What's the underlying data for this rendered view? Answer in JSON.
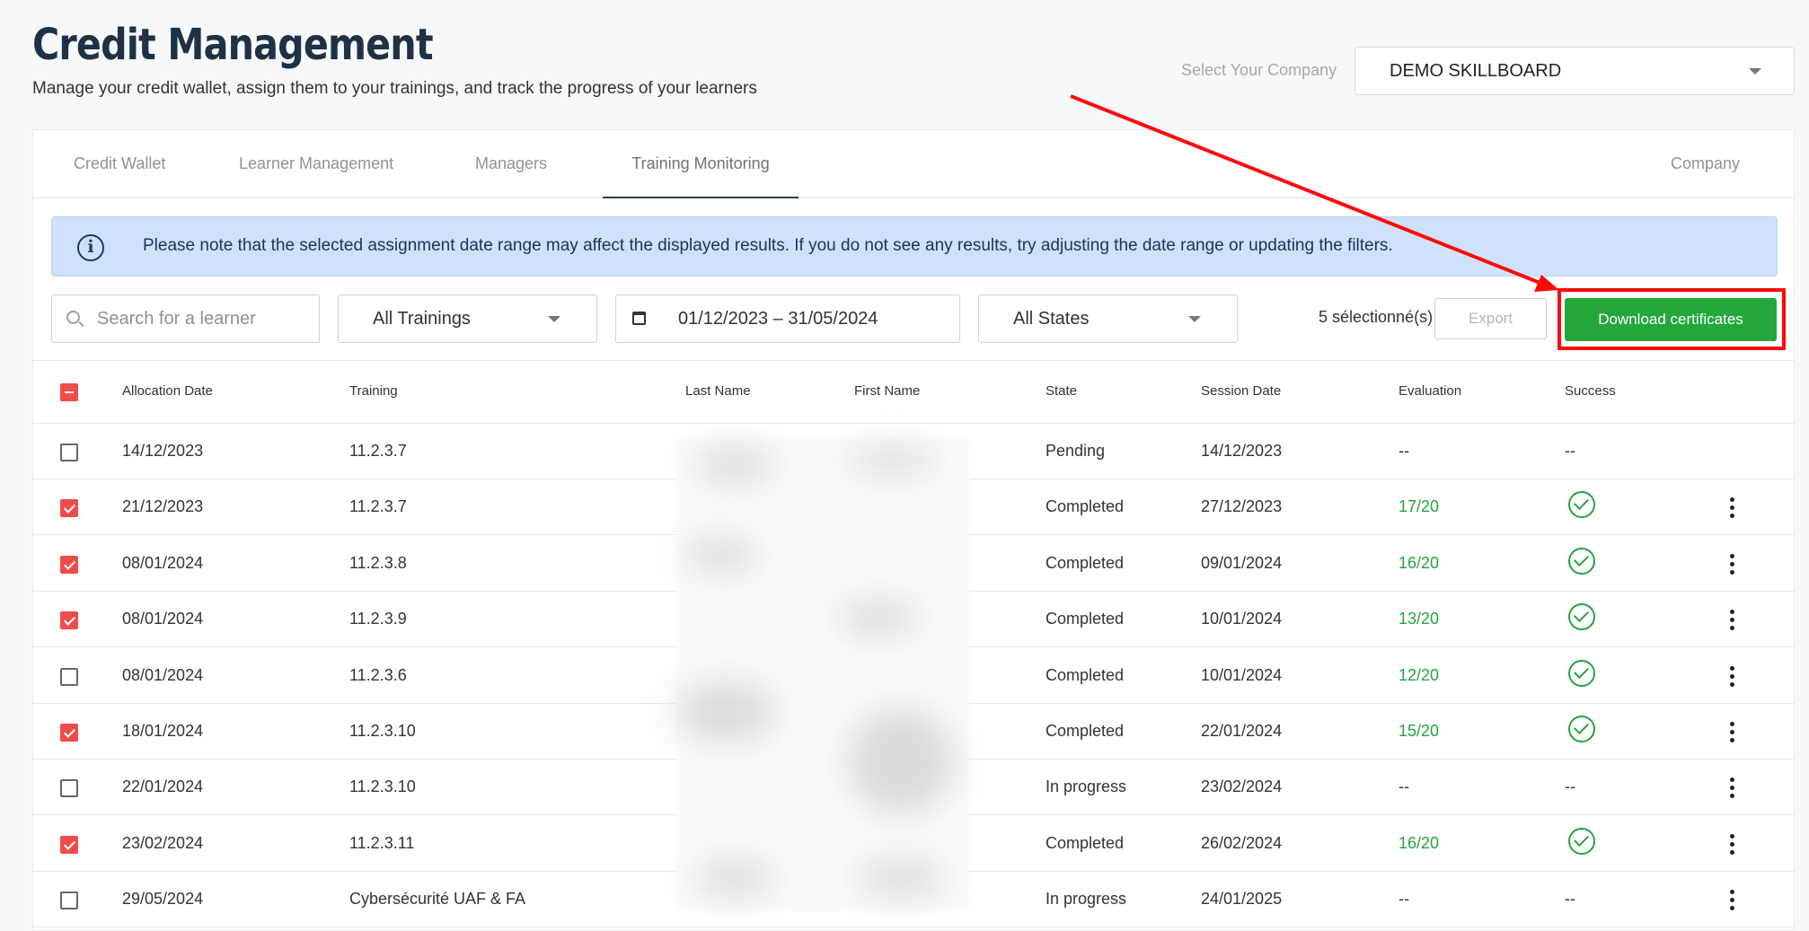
{
  "page": {
    "title": "Credit Management",
    "subtitle": "Manage your credit wallet, assign them to your trainings, and track the progress of your learners"
  },
  "company": {
    "label": "Select Your Company",
    "selected": "DEMO SKILLBOARD"
  },
  "tabs": [
    {
      "label": "Credit Wallet",
      "active": false
    },
    {
      "label": "Learner Management",
      "active": false
    },
    {
      "label": "Managers",
      "active": false
    },
    {
      "label": "Training Monitoring",
      "active": true
    },
    {
      "label": "Company",
      "active": false
    }
  ],
  "alert": {
    "text": "Please note that the selected assignment date range may affect the displayed results. If you do not see any results, try adjusting the date range or updating the filters."
  },
  "filters": {
    "search_placeholder": "Search for a learner",
    "training": "All Trainings",
    "date_range": "01/12/2023 – 31/05/2024",
    "state": "All States"
  },
  "toolbar": {
    "selected_count": "5 sélectionné(s)",
    "export_label": "Export",
    "download_label": "Download certificates"
  },
  "table": {
    "headers": [
      "Allocation Date",
      "Training",
      "Last Name",
      "First Name",
      "State",
      "Session Date",
      "Evaluation",
      "Success"
    ],
    "rows": [
      {
        "checked": false,
        "allocation_date": "14/12/2023",
        "training": "11.2.3.7",
        "state": "Pending",
        "session_date": "14/12/2023",
        "evaluation": "--",
        "success": "--"
      },
      {
        "checked": true,
        "allocation_date": "21/12/2023",
        "training": "11.2.3.7",
        "state": "Completed",
        "session_date": "27/12/2023",
        "evaluation": "17/20",
        "success": "check"
      },
      {
        "checked": true,
        "allocation_date": "08/01/2024",
        "training": "11.2.3.8",
        "state": "Completed",
        "session_date": "09/01/2024",
        "evaluation": "16/20",
        "success": "check"
      },
      {
        "checked": true,
        "allocation_date": "08/01/2024",
        "training": "11.2.3.9",
        "state": "Completed",
        "session_date": "10/01/2024",
        "evaluation": "13/20",
        "success": "check"
      },
      {
        "checked": false,
        "allocation_date": "08/01/2024",
        "training": "11.2.3.6",
        "state": "Completed",
        "session_date": "10/01/2024",
        "evaluation": "12/20",
        "success": "check"
      },
      {
        "checked": true,
        "allocation_date": "18/01/2024",
        "training": "11.2.3.10",
        "state": "Completed",
        "session_date": "22/01/2024",
        "evaluation": "15/20",
        "success": "check"
      },
      {
        "checked": false,
        "allocation_date": "22/01/2024",
        "training": "11.2.3.10",
        "state": "In progress",
        "session_date": "23/02/2024",
        "evaluation": "--",
        "success": "--"
      },
      {
        "checked": true,
        "allocation_date": "23/02/2024",
        "training": "11.2.3.11",
        "state": "Completed",
        "session_date": "26/02/2024",
        "evaluation": "16/20",
        "success": "check"
      },
      {
        "checked": false,
        "allocation_date": "29/05/2024",
        "training": "Cybersécurité UAF & FA",
        "state": "In progress",
        "session_date": "24/01/2025",
        "evaluation": "--",
        "success": "--"
      }
    ]
  },
  "colors": {
    "accent_green": "#23a73b",
    "checkbox_red": "#f04c4c",
    "annotation_red": "#ff0a0a",
    "alert_bg": "#cfe2fc"
  },
  "icons": [
    "info-icon",
    "search-icon",
    "calendar-icon",
    "chevron-down-icon",
    "check-circle-icon",
    "kebab-menu-icon"
  ]
}
